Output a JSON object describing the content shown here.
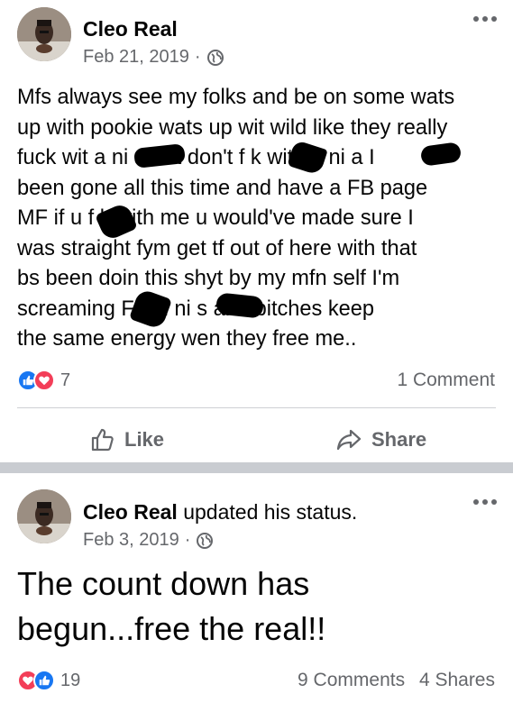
{
  "colors": {
    "like_blue": "#1877f2",
    "love_red": "#f33e58",
    "secondary_text": "#65676b",
    "separator": "#c9ccd1"
  },
  "post1": {
    "author": "Cleo Real",
    "date": "Feb 21, 2019",
    "dot": "·",
    "privacy_icon": "globe-icon",
    "text_lines": [
      "Mfs always see my folks and be on some wats",
      "up with pookie wats up wit wild like they really",
      "fuck wit a ni   a but don't f   k wit no ni   a I",
      "been gone all this time and have a FB page",
      "MF if u f    k with me u would've made sure I",
      "was straight fym get tf out of here with that",
      "bs been doin this shyt by my mfn self I'm",
      "screaming F   k u ni     s and bitches keep",
      "the same energy wen they free me.."
    ],
    "reaction_icons": [
      "like-icon",
      "love-icon"
    ],
    "reaction_count": "7",
    "comments": "1 Comment",
    "actions": {
      "like": "Like",
      "share": "Share"
    }
  },
  "post2": {
    "author": "Cleo Real",
    "verb": "updated his status.",
    "date": "Feb 3, 2019",
    "dot": "·",
    "privacy_icon": "globe-icon",
    "text_lines": [
      "The count down has",
      "begun...free the real!!"
    ],
    "reaction_icons": [
      "love-icon",
      "like-icon"
    ],
    "reaction_count": "19",
    "comments": "9 Comments",
    "shares": "4 Shares"
  }
}
